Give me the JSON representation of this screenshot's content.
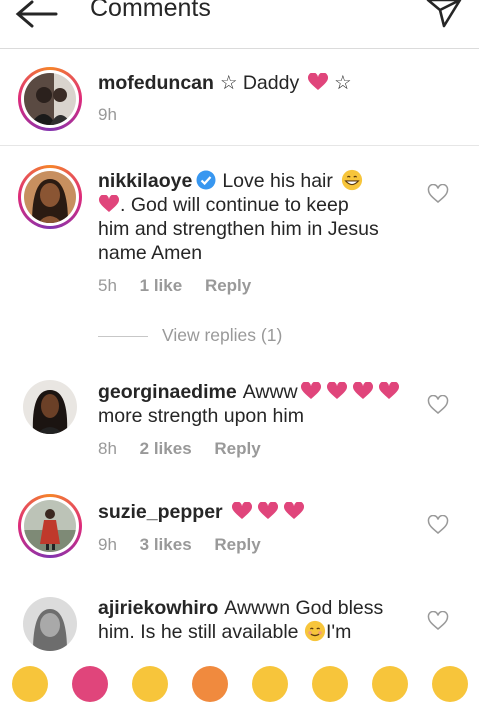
{
  "header": {
    "title": "Comments"
  },
  "caption": {
    "username": "mofeduncan",
    "text": "☆ Daddy",
    "star_end": "☆",
    "time": "9h"
  },
  "comments": [
    {
      "username": "nikkilaoye",
      "verified": true,
      "line1": "Love his hair",
      "line2": ". God will continue to keep",
      "line3": "him and strengthen him in Jesus",
      "line4": "name Amen",
      "time": "5h",
      "likes": "1 like",
      "reply": "Reply"
    },
    {
      "username": "georginaedime",
      "line1": "Awww",
      "line2": "more strength upon him",
      "time": "8h",
      "likes": "2 likes",
      "reply": "Reply"
    },
    {
      "username": "suzie_pepper",
      "time": "9h",
      "likes": "3 likes",
      "reply": "Reply"
    },
    {
      "username": "ajiriekowhiro",
      "line1": "Awwwn God bless",
      "line2": "him. Is he still available",
      "line2_end": "I'm"
    }
  ],
  "view_replies": "View replies (1)",
  "colors": {
    "heart": "#e0457b",
    "muted": "#999999",
    "verified": "#3897f0"
  }
}
